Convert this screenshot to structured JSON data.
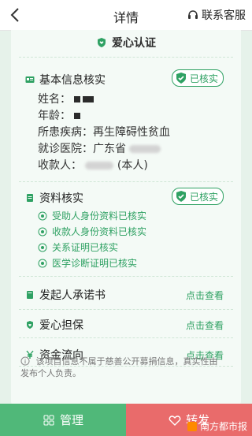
{
  "header": {
    "title": "详情",
    "service_label": "联系客服"
  },
  "certification": {
    "label": "爱心认证"
  },
  "basic_info": {
    "title": "基本信息核实",
    "badge": "已核实",
    "name_label": "姓名：",
    "age_label": "年龄：",
    "disease": "所患疾病：再生障碍性贫血",
    "hospital_label": "就诊医院：广东省",
    "payee_label": "收款人：",
    "payee_suffix": "(本人)"
  },
  "docs": {
    "title": "资料核实",
    "badge": "已核实",
    "items": [
      "受助人身份资料已核实",
      "收款人身份资料已核实",
      "关系证明已核实",
      "医学诊断证明已核实"
    ]
  },
  "pledge": {
    "title": "发起人承诺书",
    "link": "点击查看"
  },
  "guarantee": {
    "title": "爱心担保",
    "link": "点击查看"
  },
  "funds": {
    "title": "资金流向",
    "link": "点击查看"
  },
  "note": "该项目信息不属于慈善公开募捐信息，真实性由发布个人负责。",
  "bottom": {
    "manage_label": "管理",
    "share_label": "转发"
  },
  "watermark": "南方都市报",
  "colors": {
    "accent": "#2fa163",
    "manage_bg": "#50b879",
    "share_bg": "#e96b6b"
  }
}
